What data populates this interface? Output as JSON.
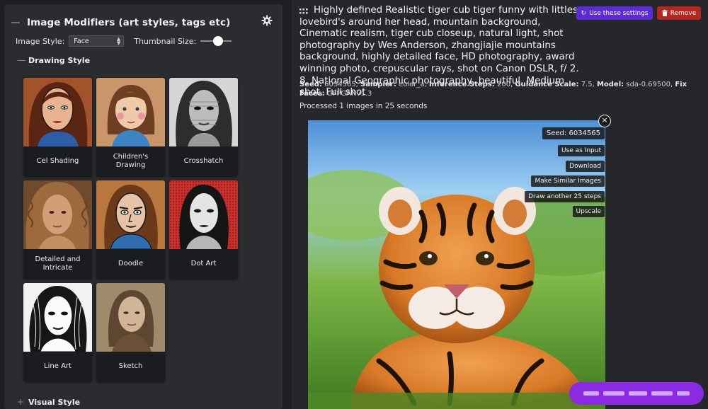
{
  "left": {
    "title": "Image Modifiers (art styles, tags etc)",
    "image_style_label": "Image Style:",
    "image_style_value": "Face",
    "thumbnail_size_label": "Thumbnail Size:",
    "drawing_style_label": "Drawing Style",
    "visual_style_label": "Visual Style",
    "cards": [
      {
        "label": "Cel Shading"
      },
      {
        "label": "Children's Drawing"
      },
      {
        "label": "Crosshatch"
      },
      {
        "label": "Detailed and Intricate"
      },
      {
        "label": "Doodle"
      },
      {
        "label": "Dot Art"
      },
      {
        "label": "Line Art"
      },
      {
        "label": "Sketch"
      }
    ]
  },
  "task": {
    "prompt": "Highly defined Realistic tiger cub tiger funny with littles lovebird's around her head, mountain background, Cinematic realism, tiger cub closeup, natural light, shot photography by Wes Anderson, zhangjiajie mountains background, highly detailed face, HD photography, award winning photo, crepuscular rays, shot on Canon DSLR, f/ 2. 8, National Geographic photography, beautiful, Medium shot, Full shot",
    "use_settings_label": "Use these settings",
    "remove_label": "Remove",
    "meta": {
      "seed_label": "Seed:",
      "seed": "6034565",
      "sampler_label": "Sampler:",
      "sampler": "euler_a",
      "steps_label": "Inference Steps:",
      "steps": "200",
      "guidance_label": "Guidance Scale:",
      "guidance": "7.5",
      "model_label": "Model:",
      "model": "sda-0.69500",
      "fix_faces_label": "Fix Faces:",
      "fix_faces": "GFPGANv1.3"
    },
    "processed_text": "Processed 1 images in 25 seconds"
  },
  "image_actions": {
    "seed": "Seed: 6034565",
    "use_as_input": "Use as Input",
    "download": "Download",
    "make_similar": "Make Similar Images",
    "draw_another": "Draw another 25 steps",
    "upscale": "Upscale"
  },
  "colors": {
    "accent_purple": "#5b2bd6",
    "remove_red": "#b3271f",
    "floating_button": "#8a2be2"
  }
}
